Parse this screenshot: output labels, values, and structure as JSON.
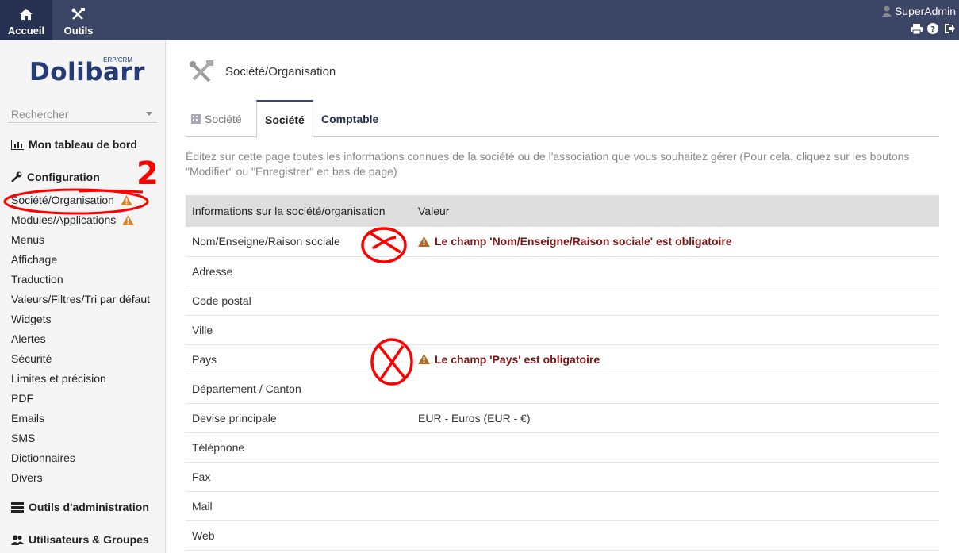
{
  "topnav": {
    "items": [
      {
        "label": "Accueil",
        "icon": "home-icon",
        "active": true
      },
      {
        "label": "Outils",
        "icon": "tools-icon",
        "active": false
      }
    ],
    "user": "SuperAdmin"
  },
  "sidebar": {
    "logo": "Dolibarr",
    "logo_sub": "ERP/CRM",
    "search_placeholder": "Rechercher",
    "dashboard": "Mon tableau de bord",
    "config_heading": "Configuration",
    "items": [
      {
        "label": "Société/Organisation",
        "warning": true
      },
      {
        "label": "Modules/Applications",
        "warning": true
      },
      {
        "label": "Menus"
      },
      {
        "label": "Affichage"
      },
      {
        "label": "Traduction"
      },
      {
        "label": "Valeurs/Filtres/Tri par défaut"
      },
      {
        "label": "Widgets"
      },
      {
        "label": "Alertes"
      },
      {
        "label": "Sécurité"
      },
      {
        "label": "Limites et précision"
      },
      {
        "label": "PDF"
      },
      {
        "label": "Emails"
      },
      {
        "label": "SMS"
      },
      {
        "label": "Dictionnaires"
      },
      {
        "label": "Divers"
      }
    ],
    "admin_tools": "Outils d'administration",
    "users_groups": "Utilisateurs & Groupes"
  },
  "main": {
    "title": "Société/Organisation",
    "tabs": [
      {
        "label": "Société"
      },
      {
        "label": "Société"
      },
      {
        "label": "Comptable"
      }
    ],
    "description": "Éditez sur cette page toutes les informations connues de la société ou de l'association que vous souhaitez gérer (Pour cela, cliquez sur les boutons \"Modifier\" ou \"Enregistrer\" en bas de page)",
    "table": {
      "headers": [
        "Informations sur la société/organisation",
        "Valeur"
      ],
      "rows": [
        {
          "label": "Nom/Enseigne/Raison sociale",
          "value": "Le champ 'Nom/Enseigne/Raison sociale' est obligatoire"
        },
        {
          "label": "Adresse",
          "value": ""
        },
        {
          "label": "Code postal",
          "value": ""
        },
        {
          "label": "Ville",
          "value": ""
        },
        {
          "label": "Pays",
          "value": "Le champ 'Pays' est obligatoire"
        },
        {
          "label": "Département / Canton",
          "value": ""
        },
        {
          "label": "Devise principale",
          "value": "EUR - Euros (EUR - €)"
        },
        {
          "label": "Téléphone",
          "value": ""
        },
        {
          "label": "Fax",
          "value": ""
        },
        {
          "label": "Mail",
          "value": ""
        },
        {
          "label": "Web",
          "value": ""
        }
      ]
    }
  },
  "annotations": {
    "number": "2"
  },
  "colors": {
    "topbar": "#3b4566",
    "error": "#7a1616",
    "warning": "#d9822b",
    "annotation": "#ff0000"
  }
}
